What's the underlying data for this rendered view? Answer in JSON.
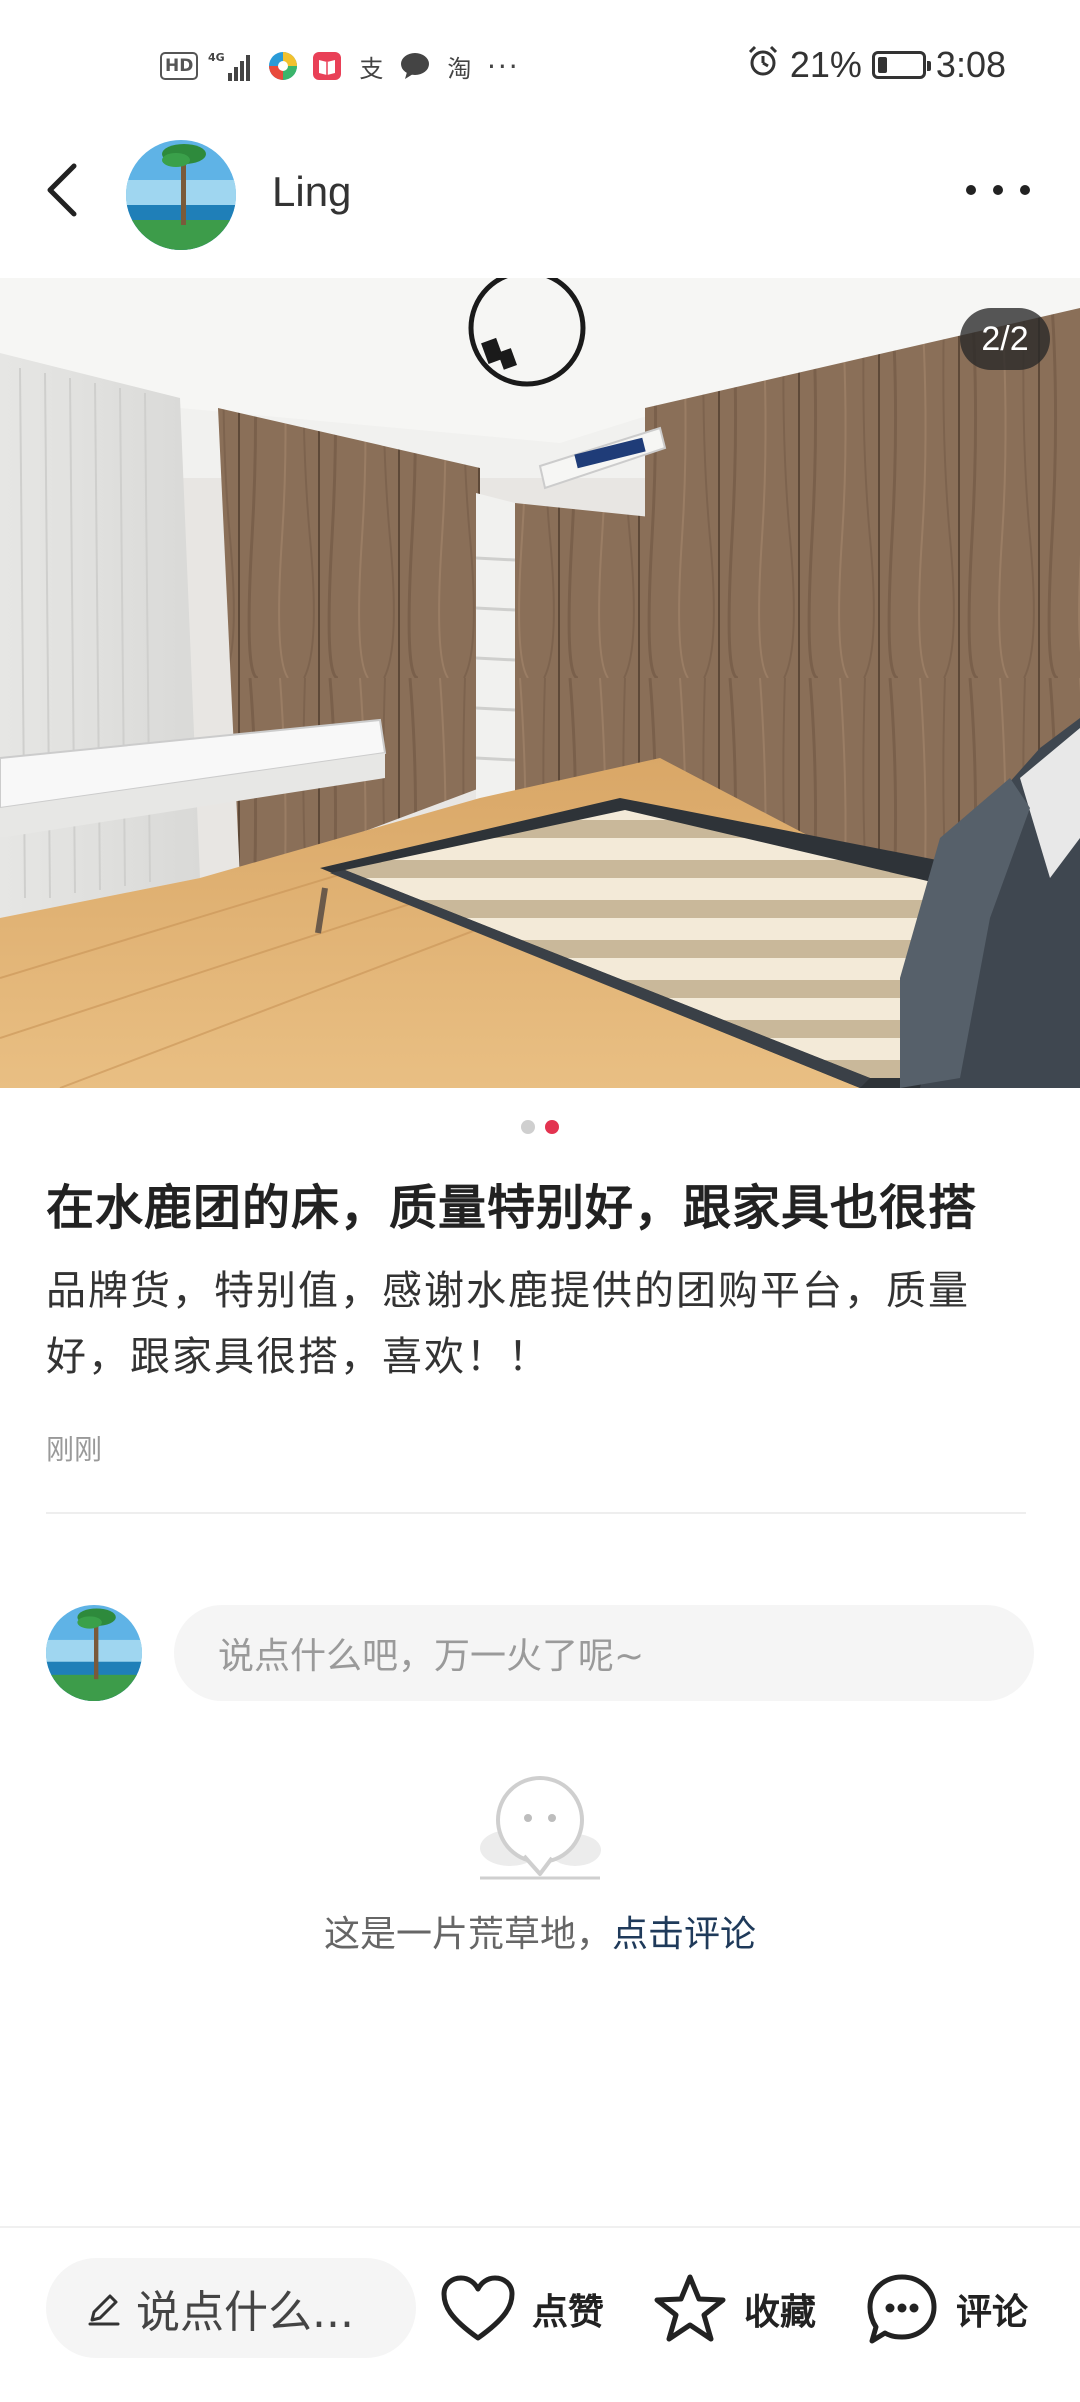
{
  "status_bar": {
    "hd": "HD",
    "network": "4G",
    "battery_percent": "21%",
    "battery_level": 0.21,
    "time": "3:08",
    "icons": [
      "signal-icon",
      "browser-app-icon",
      "reader-app-icon",
      "alipay-icon",
      "chat-icon",
      "taobao-icon",
      "more-notifications-icon",
      "alarm-icon",
      "battery-icon"
    ]
  },
  "header": {
    "author_name": "Ling"
  },
  "photo": {
    "counter": "2/2",
    "pager": {
      "total": 2,
      "active": 2
    }
  },
  "post": {
    "title": "在水鹿团的床，质量特别好，跟家具也很搭",
    "body": "品牌货，特别值，感谢水鹿提供的团购平台，质量好，跟家具很搭，喜欢！！",
    "time": "刚刚"
  },
  "comment_box": {
    "placeholder": "说点什么吧，万一火了呢~"
  },
  "empty_state": {
    "text": "这是一片荒草地，",
    "link": "点击评论"
  },
  "bottom_bar": {
    "input_label": "说点什么...",
    "like_label": "点赞",
    "favorite_label": "收藏",
    "comment_label": "评论"
  },
  "colors": {
    "accent": "#e33350",
    "link": "#1f3a5a"
  }
}
